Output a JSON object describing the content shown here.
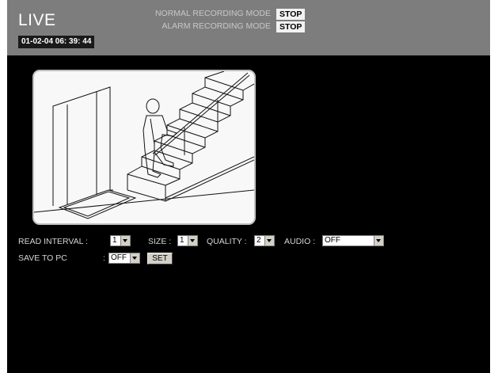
{
  "header": {
    "title": "LIVE",
    "timestamp": "01-02-04  06: 39: 44",
    "normal_mode_label": "NORMAL RECORDING MODE",
    "normal_mode_status": "STOP",
    "alarm_mode_label": "ALARM RECORDING MODE",
    "alarm_mode_status": "STOP"
  },
  "camera": {
    "image_subject": "person climbing stairs with handrail next to doorway"
  },
  "controls": {
    "read_interval_label": "READ INTERVAL :",
    "read_interval_value": "1",
    "size_label": "SIZE :",
    "size_value": "1",
    "quality_label": "QUALITY :",
    "quality_value": "2",
    "audio_label": "AUDIO :",
    "audio_value": "OFF",
    "save_to_pc_label": "SAVE TO PC",
    "save_to_pc_colon": ":",
    "save_to_pc_value": "OFF",
    "set_label": "SET"
  },
  "colors": {
    "header_bg": "#7d7d7d",
    "page_bg": "#000000",
    "status_bg": "#f2f2f2"
  }
}
